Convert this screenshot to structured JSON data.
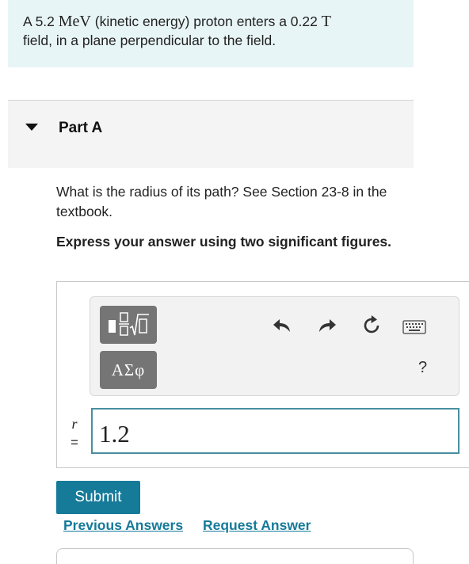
{
  "problem": {
    "prefix": "A 5.2 ",
    "energy_unit": "MeV",
    "middle": " (kinetic energy) proton enters a 0.22 ",
    "field_unit": "T",
    "line2": "field, in a plane perpendicular to the field."
  },
  "part": {
    "title": "Part A",
    "question": "What is the radius of its path? See Section 23-8 in the textbook.",
    "instruction": "Express your answer using two significant figures."
  },
  "toolbar": {
    "greek_label": "ΑΣφ",
    "help_label": "?"
  },
  "answer": {
    "variable": "r",
    "equals": "=",
    "value": "1.2"
  },
  "actions": {
    "submit_label": "Submit",
    "previous_answers_label": "Previous Answers",
    "request_answer_label": "Request Answer"
  },
  "colors": {
    "problem_bg": "#e8f5f6",
    "accent": "#167a99",
    "input_border": "#4a8fa0"
  }
}
